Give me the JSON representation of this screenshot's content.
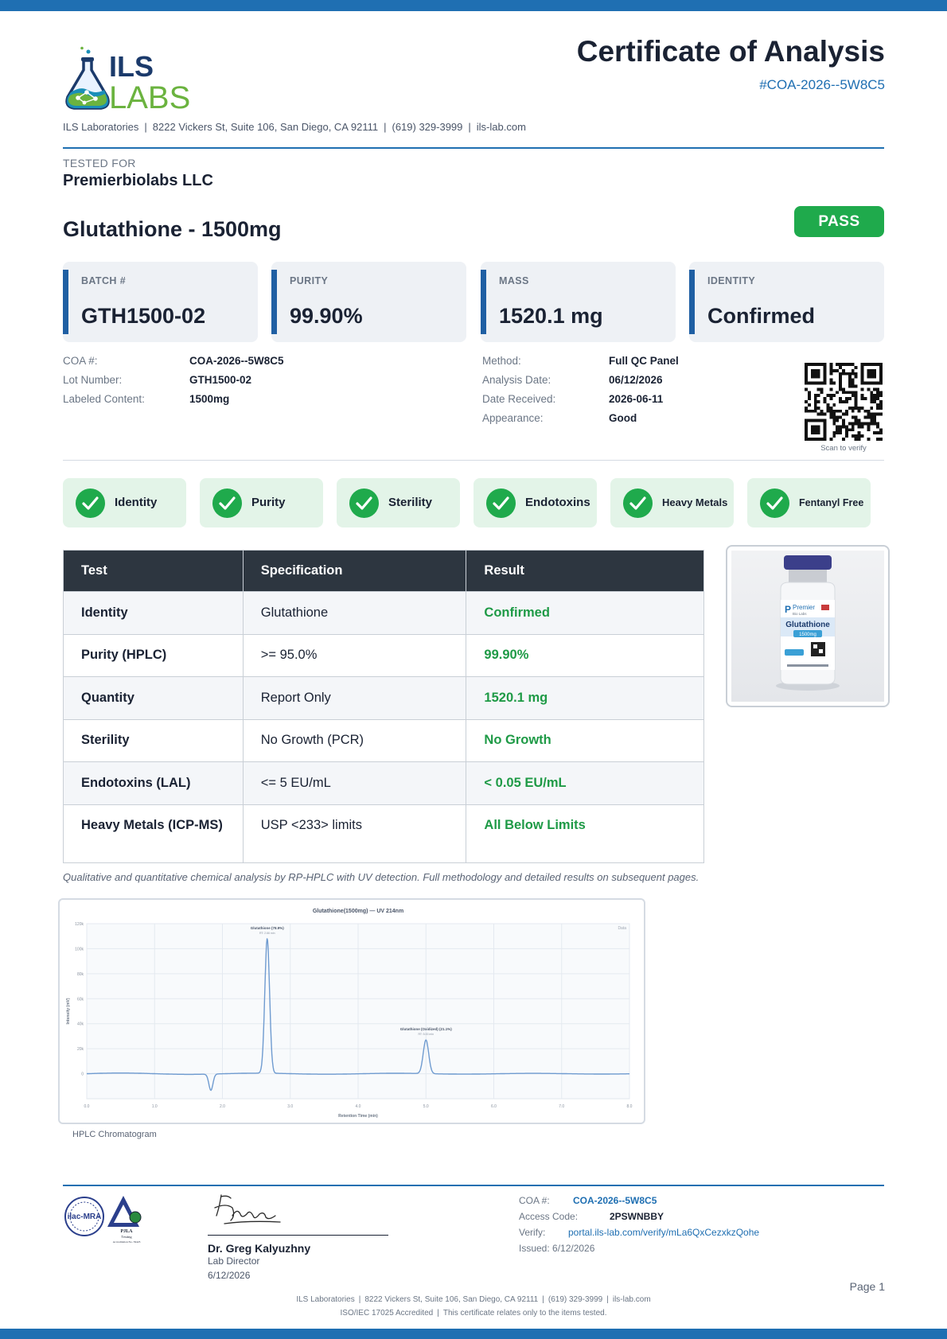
{
  "header": {
    "logo_text_top": "ILS",
    "logo_text_bottom": "LABS",
    "company": "ILS Laboratories",
    "address": "8222 Vickers St, Suite 106, San Diego, CA 92111",
    "phone": "(619) 329-3999",
    "website": "ils-lab.com",
    "title": "Certificate of Analysis",
    "coa_id": "#COA-2026--5W8C5"
  },
  "client": {
    "label": "TESTED FOR",
    "name": "Premierbiolabs LLC"
  },
  "product": {
    "name": "Glutathione - 1500mg",
    "status": "PASS"
  },
  "cards": [
    {
      "label": "BATCH #",
      "value": "GTH1500-02"
    },
    {
      "label": "PURITY",
      "value": "99.90%"
    },
    {
      "label": "MASS",
      "value": "1520.1 mg"
    },
    {
      "label": "IDENTITY",
      "value": "Confirmed"
    }
  ],
  "details_left": [
    {
      "key": "COA #:",
      "value": "COA-2026--5W8C5"
    },
    {
      "key": "Lot Number:",
      "value": "GTH1500-02"
    },
    {
      "key": "Labeled Content:",
      "value": "1500mg"
    }
  ],
  "details_right": [
    {
      "key": "Method:",
      "value": "Full QC Panel"
    },
    {
      "key": "Analysis Date:",
      "value": "06/12/2026"
    },
    {
      "key": "Date Received:",
      "value": "2026-06-11"
    },
    {
      "key": "Appearance:",
      "value": "Good"
    }
  ],
  "qr_caption": "Scan to verify",
  "checks": [
    "Identity",
    "Purity",
    "Sterility",
    "Endotoxins",
    "Heavy Metals",
    "Fentanyl Free"
  ],
  "table": {
    "headers": [
      "Test",
      "Specification",
      "Result"
    ],
    "rows": [
      {
        "test": "Identity",
        "spec": "Glutathione",
        "result": "Confirmed"
      },
      {
        "test": "Purity (HPLC)",
        "spec": ">= 95.0%",
        "result": "99.90%"
      },
      {
        "test": "Quantity",
        "spec": "Report Only",
        "result": "1520.1 mg"
      },
      {
        "test": "Sterility",
        "spec": "No Growth (PCR)",
        "result": "No Growth"
      },
      {
        "test": "Endotoxins (LAL)",
        "spec": "<= 5 EU/mL",
        "result": "< 0.05 EU/mL"
      },
      {
        "test": "Heavy Metals (ICP-MS)",
        "spec": "USP <233> limits",
        "result": "All Below Limits"
      }
    ]
  },
  "vial": {
    "brand": "Premier",
    "brand_sub": "Bio Labs",
    "product": "Glutathione",
    "dose": "1500mg"
  },
  "method_note": "Qualitative and quantitative chemical analysis by RP-HPLC with UV detection. Full methodology and detailed results on subsequent pages.",
  "chart_data": {
    "type": "line",
    "title": "Glutathione(1500mg) — UV 214nm",
    "xlabel": "Retention Time (min)",
    "ylabel": "Intensity (mV)",
    "xlim": [
      0,
      8
    ],
    "ylim": [
      -20000,
      120000
    ],
    "xticks": [
      "0.0",
      "1.0",
      "2.0",
      "3.0",
      "4.0",
      "5.0",
      "6.0",
      "7.0",
      "8.0"
    ],
    "yticks": [
      "0",
      "20k",
      "40k",
      "60k",
      "80k",
      "100k",
      "120k"
    ],
    "legend": "Data",
    "grid": true,
    "peaks": [
      {
        "label": "Glutathione (78.9%)",
        "sub": "RT: 2.66 min",
        "rt": 2.66,
        "height": 108000
      },
      {
        "label": "Glutathione (Oxidized) (21.1%)",
        "sub": "RT: 5.00 min",
        "rt": 5.0,
        "height": 27000
      }
    ],
    "dips": [
      {
        "rt": 1.83,
        "depth": -13000
      }
    ],
    "baseline": 0
  },
  "chart_caption": "HPLC Chromatogram",
  "seals": {
    "ilac": "ilac-MRA",
    "pjla_top": "PJLA",
    "pjla_mid": "Testing",
    "pjla_bottom": "Accreditation No. 59423"
  },
  "signer": {
    "name": "Dr. Greg Kalyuzhny",
    "role": "Lab Director",
    "date": "6/12/2026"
  },
  "verification": {
    "coa_label": "COA #:",
    "coa_value": "COA-2026--5W8C5",
    "access_label": "Access Code:",
    "access_value": "2PSWNBBY",
    "verify_label": "Verify:",
    "verify_value": "portal.ils-lab.com/verify/mLa6QxCezxkzQohe",
    "issued": "Issued: 6/12/2026"
  },
  "footer": {
    "page": "Page 1",
    "company": "ILS Laboratories",
    "address": "8222 Vickers St, Suite 106, San Diego, CA 92111",
    "phone": "(619) 329-3999",
    "website": "ils-lab.com",
    "accreditation": "ISO/IEC 17025 Accredited",
    "disclaimer": "This certificate relates only to the items tested."
  },
  "colors": {
    "brand_blue": "#1f6fb2",
    "pass_green": "#1faa4c",
    "result_green": "#1e9a46",
    "header_dark": "#2d3640",
    "logo_green": "#6bb33f",
    "logo_navy": "#1b3a6b"
  }
}
